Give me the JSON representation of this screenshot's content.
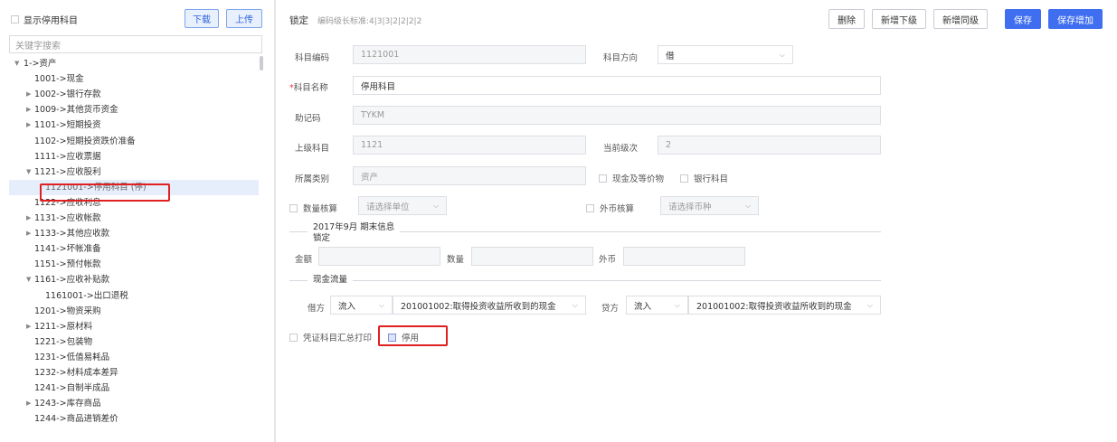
{
  "left_panel": {
    "show_disabled_label": "显示停用科目",
    "download_label": "下载",
    "upload_label": "上传",
    "search_placeholder": "关键字搜索",
    "tree": [
      {
        "label": "1->资产",
        "indent": 0,
        "arrow": "down",
        "selected": false
      },
      {
        "label": "1001->现金",
        "indent": 1,
        "arrow": "",
        "selected": false
      },
      {
        "label": "1002->银行存款",
        "indent": 1,
        "arrow": "right",
        "selected": false
      },
      {
        "label": "1009->其他货币资金",
        "indent": 1,
        "arrow": "right",
        "selected": false
      },
      {
        "label": "1101->短期投资",
        "indent": 1,
        "arrow": "right",
        "selected": false
      },
      {
        "label": "1102->短期投资跌价准备",
        "indent": 1,
        "arrow": "",
        "selected": false
      },
      {
        "label": "1111->应收票据",
        "indent": 1,
        "arrow": "",
        "selected": false
      },
      {
        "label": "1121->应收股利",
        "indent": 1,
        "arrow": "down",
        "selected": false
      },
      {
        "label": "1121001->停用科目 (停)",
        "indent": 2,
        "arrow": "",
        "selected": true
      },
      {
        "label": "1122->应收利息",
        "indent": 1,
        "arrow": "",
        "selected": false
      },
      {
        "label": "1131->应收帐款",
        "indent": 1,
        "arrow": "right",
        "selected": false
      },
      {
        "label": "1133->其他应收款",
        "indent": 1,
        "arrow": "right",
        "selected": false
      },
      {
        "label": "1141->坏帐准备",
        "indent": 1,
        "arrow": "",
        "selected": false
      },
      {
        "label": "1151->预付帐款",
        "indent": 1,
        "arrow": "",
        "selected": false
      },
      {
        "label": "1161->应收补贴款",
        "indent": 1,
        "arrow": "down",
        "selected": false
      },
      {
        "label": "1161001->出口退税",
        "indent": 2,
        "arrow": "",
        "selected": false
      },
      {
        "label": "1201->物资采购",
        "indent": 1,
        "arrow": "",
        "selected": false
      },
      {
        "label": "1211->原材料",
        "indent": 1,
        "arrow": "right",
        "selected": false
      },
      {
        "label": "1221->包装物",
        "indent": 1,
        "arrow": "",
        "selected": false
      },
      {
        "label": "1231->低值易耗品",
        "indent": 1,
        "arrow": "",
        "selected": false
      },
      {
        "label": "1232->材料成本差异",
        "indent": 1,
        "arrow": "",
        "selected": false
      },
      {
        "label": "1241->自制半成品",
        "indent": 1,
        "arrow": "",
        "selected": false
      },
      {
        "label": "1243->库存商品",
        "indent": 1,
        "arrow": "right",
        "selected": false
      },
      {
        "label": "1244->商品进销差价",
        "indent": 1,
        "arrow": "",
        "selected": false
      }
    ]
  },
  "header": {
    "title": "锁定",
    "subtitle": "编码级长标准:4|3|3|2|2|2|2",
    "delete_label": "删除",
    "add_child_label": "新增下级",
    "add_sibling_label": "新增同级",
    "save_label": "保存",
    "save_add_label": "保存增加"
  },
  "form": {
    "code_label": "科目编码",
    "code_value": "1121001",
    "direction_label": "科目方向",
    "direction_value": "借",
    "name_required_mark": "*",
    "name_label": "科目名称",
    "name_value": "停用科目",
    "mnemonic_label": "助记码",
    "mnemonic_value": "TYKM",
    "parent_label": "上级科目",
    "parent_value": "1121",
    "level_label": "当前级次",
    "level_value": "2",
    "category_label": "所属类别",
    "category_value": "资产",
    "cash_equiv_label": "现金及等价物",
    "bank_label": "银行科目",
    "qty_label": "数量核算",
    "unit_placeholder": "请选择单位",
    "fx_label": "外币核算",
    "currency_placeholder": "请选择币种",
    "period_title_line1": "2017年9月 期末信息",
    "period_title_line2": "锁定",
    "amount_label": "金额",
    "quantity_label": "数量",
    "foreign_label": "外币",
    "cashflow_title": "现金流量",
    "debit_label": "借方",
    "debit_dir": "流入",
    "debit_item": "201001002:取得投资收益所收到的现金",
    "credit_label": "贷方",
    "credit_dir": "流入",
    "credit_item": "201001002:取得投资收益所收到的现金",
    "voucher_print_label": "凭证科目汇总打印",
    "disabled_label": "停用",
    "disabled_checked": true
  }
}
